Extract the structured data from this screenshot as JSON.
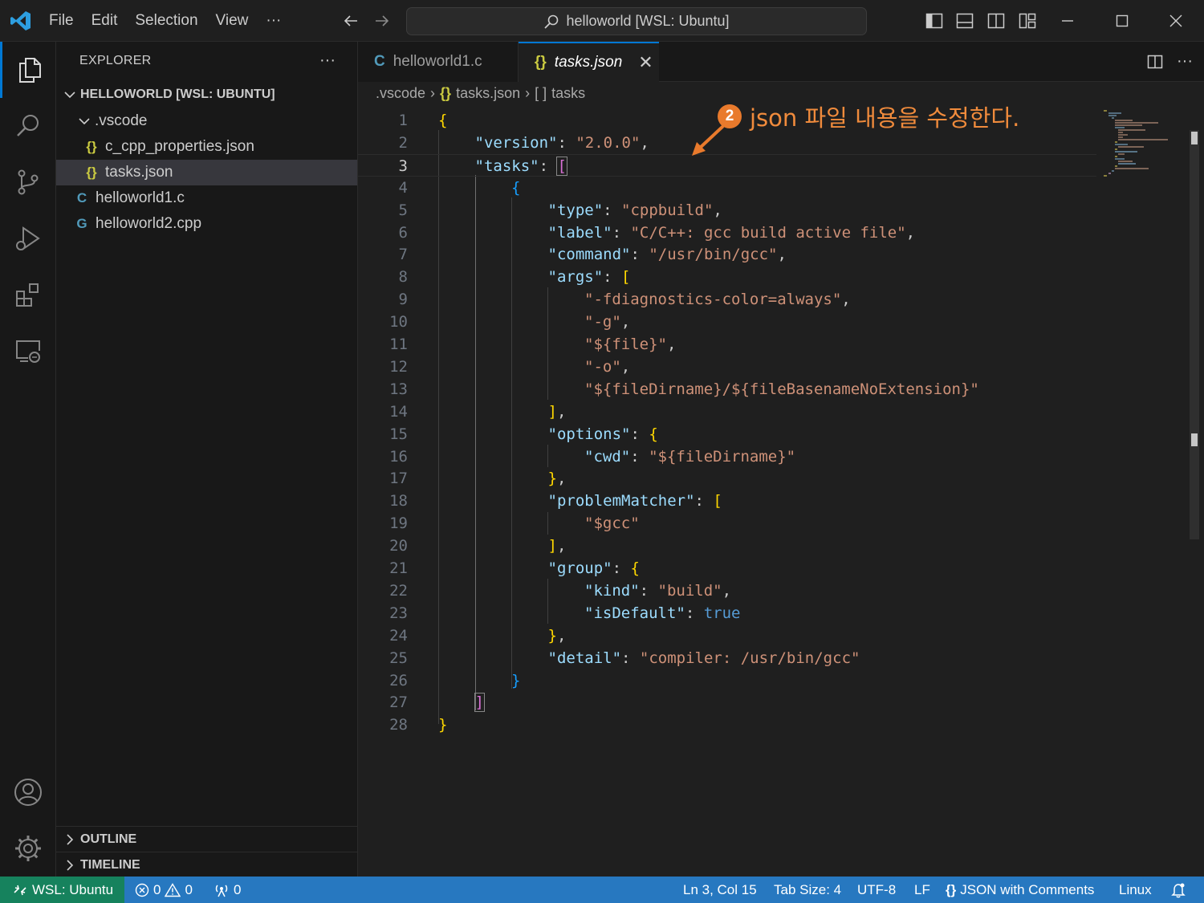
{
  "titlebar": {
    "menu": [
      "File",
      "Edit",
      "Selection",
      "View",
      "···"
    ],
    "command_center": "helloworld [WSL: Ubuntu]"
  },
  "explorer": {
    "title": "EXPLORER",
    "more": "···",
    "root": "HELLOWORLD [WSL: UBUNTU]",
    "folder": ".vscode",
    "files": [
      {
        "icon": "{}",
        "name": "c_cpp_properties.json"
      },
      {
        "icon": "{}",
        "name": "tasks.json"
      },
      {
        "icon": "C",
        "name": "helloworld1.c"
      },
      {
        "icon": "G",
        "name": "helloworld2.cpp"
      }
    ],
    "outline": "OUTLINE",
    "timeline": "TIMELINE"
  },
  "tabs": {
    "inactive": {
      "icon": "C",
      "label": "helloworld1.c"
    },
    "active": {
      "icon": "{}",
      "label": "tasks.json",
      "close": "✕"
    }
  },
  "breadcrumb": {
    "folder": ".vscode",
    "file": "tasks.json",
    "symbol": "tasks",
    "symbol_icon": "[ ]",
    "file_icon": "{}"
  },
  "editor": {
    "line_numbers": [
      "1",
      "2",
      "3",
      "4",
      "5",
      "6",
      "7",
      "8",
      "9",
      "10",
      "11",
      "12",
      "13",
      "14",
      "15",
      "16",
      "17",
      "18",
      "19",
      "20",
      "21",
      "22",
      "23",
      "24",
      "25",
      "26",
      "27",
      "28"
    ],
    "current_line": 3
  },
  "annotation": {
    "number": "2",
    "text": "json 파일 내용을 수정한다."
  },
  "statusbar": {
    "remote": "WSL: Ubuntu",
    "errors": "0",
    "warnings": "0",
    "ports": "0",
    "position": "Ln 3, Col 15",
    "tab_size": "Tab Size: 4",
    "encoding": "UTF-8",
    "eol": "LF",
    "language": "JSON with Comments",
    "platform": "Linux"
  },
  "colors": {
    "accent": "#0078d4",
    "statusbar": "#2778c0",
    "remote": "#16825d",
    "annotation": "#e97a2c"
  }
}
